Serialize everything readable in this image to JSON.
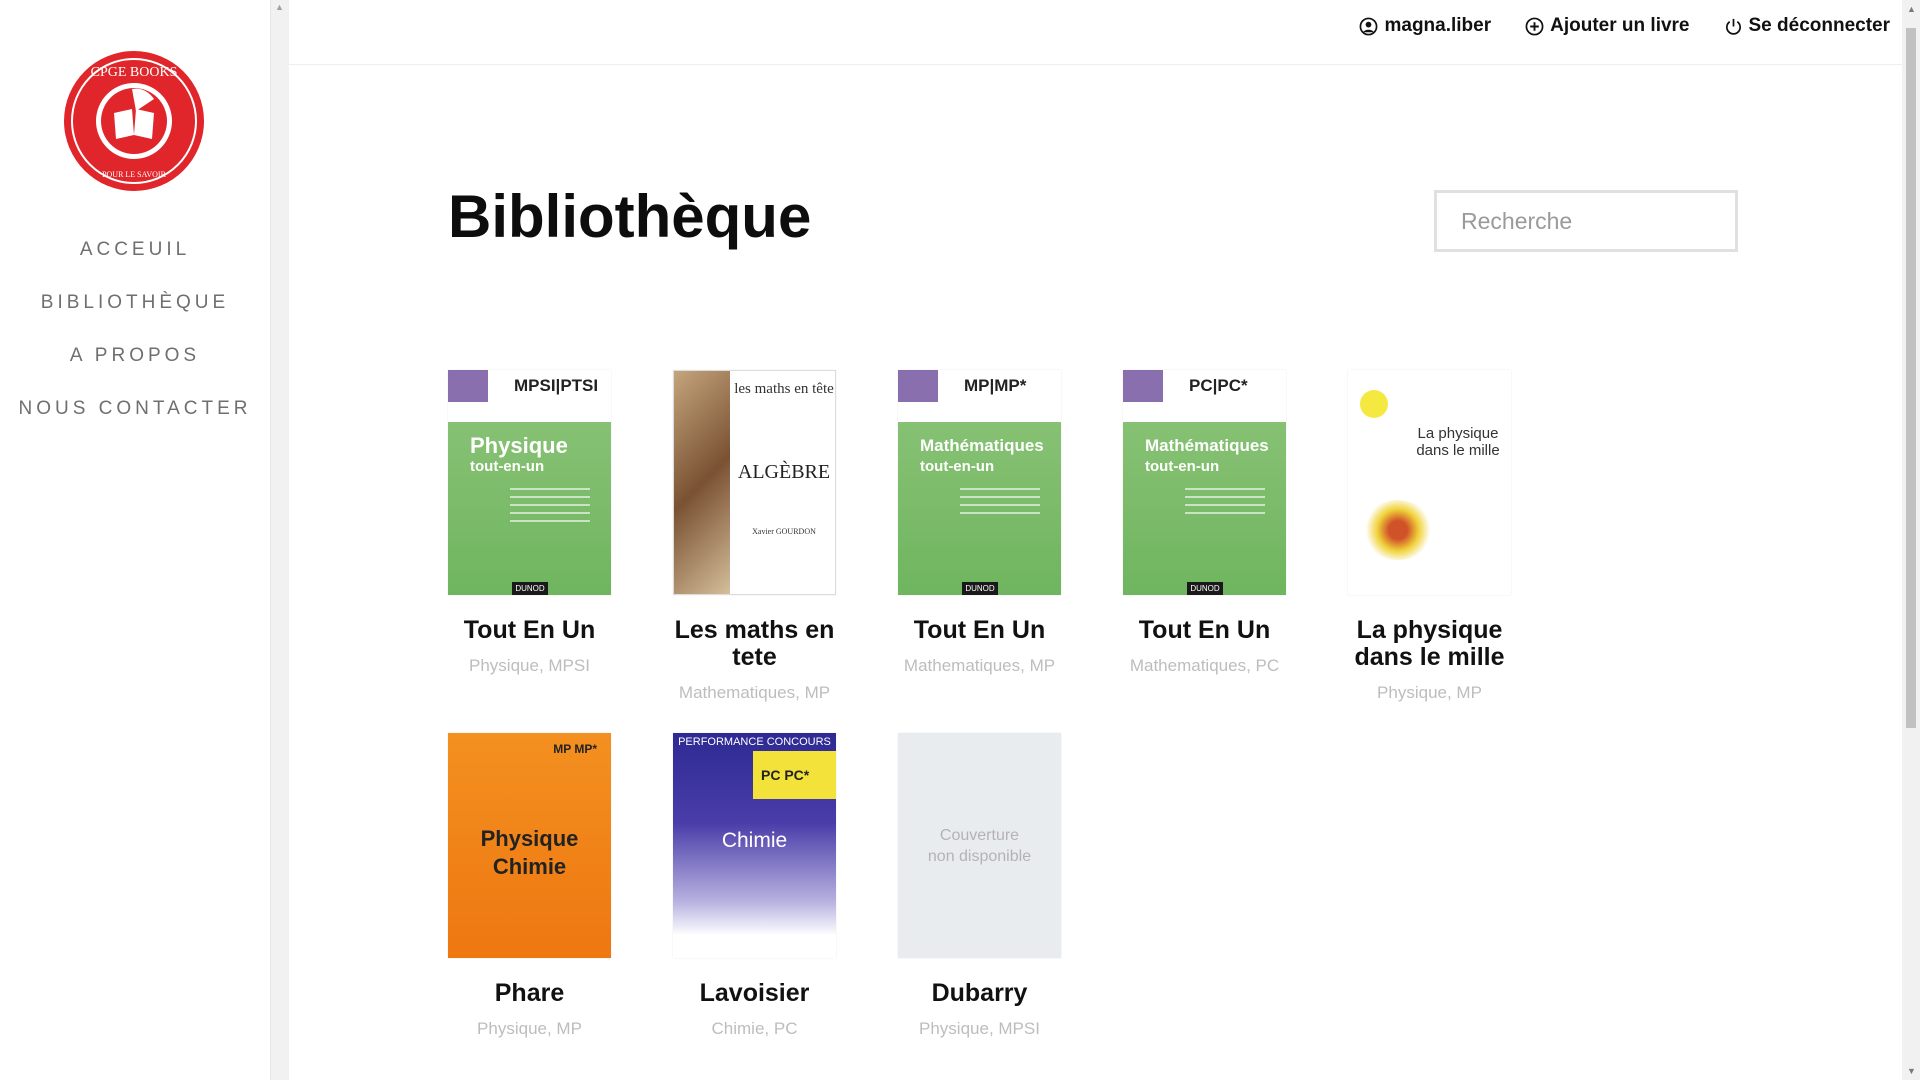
{
  "sidebar": {
    "logo_alt": "CPGE BOOKS",
    "logo_text_top": "CPGE BOOKS",
    "logo_text_bottom": "POUR LE SAVOIR",
    "nav": [
      "ACCEUIL",
      "BIBLIOTHÈQUE",
      "A PROPOS",
      "NOUS CONTACTER"
    ]
  },
  "topbar": {
    "user": "magna.liber",
    "add_book": "Ajouter un livre",
    "logout": "Se déconnecter"
  },
  "main": {
    "title": "Bibliothèque",
    "search_placeholder": "Recherche"
  },
  "books": [
    {
      "title": "Tout En Un",
      "tags": "Physique, MPSI",
      "cover": {
        "label": "MPSI|PTSI",
        "main": "Physique",
        "sub": "tout-en-un",
        "publisher": "DUNOD"
      }
    },
    {
      "title": "Les maths en tete",
      "tags": "Mathematiques, MP",
      "cover": {
        "line1": "les maths en tête",
        "main": "ALGÈBRE",
        "author": "Xavier GOURDON"
      }
    },
    {
      "title": "Tout En Un",
      "tags": "Mathematiques, MP",
      "cover": {
        "label": "MP|MP*",
        "main": "Mathématiques",
        "sub": "tout-en-un",
        "publisher": "DUNOD"
      }
    },
    {
      "title": "Tout En Un",
      "tags": "Mathematiques, PC",
      "cover": {
        "label": "PC|PC*",
        "main": "Mathématiques",
        "sub": "tout-en-un",
        "publisher": "DUNOD"
      }
    },
    {
      "title": "La physique dans le mille",
      "tags": "Physique, MP",
      "cover": {
        "main": "La physique dans le mille"
      }
    },
    {
      "title": "Phare",
      "tags": "Physique, MP",
      "cover": {
        "label": "MP MP*",
        "main": "Physique Chimie"
      }
    },
    {
      "title": "Lavoisier",
      "tags": "Chimie, PC",
      "cover": {
        "banner": "PERFORMANCE CONCOURS",
        "label": "PC PC*",
        "main": "Chimie"
      }
    },
    {
      "title": "Dubarry",
      "tags": "Physique, MPSI",
      "cover": {
        "placeholder": "Couverture non disponible"
      }
    }
  ],
  "colors": {
    "brand_red": "#e0262b",
    "text": "#111111",
    "muted": "#bdbdbd"
  }
}
